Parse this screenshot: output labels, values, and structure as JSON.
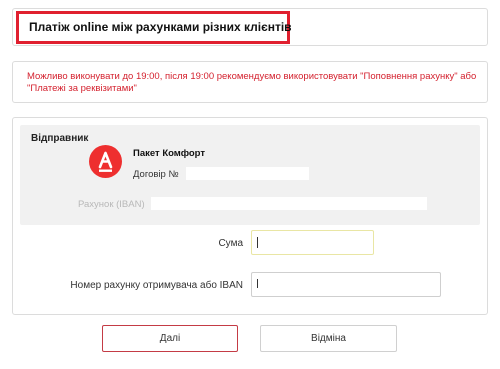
{
  "header": {
    "title": "Платіж online між рахунками різних клієнтів"
  },
  "notice": {
    "text": "Можливо виконувати до 19:00, після 19:00 рекомендуємо використовувати \"Поповнення рахунку\" або \"Платежі за реквізитами\""
  },
  "sender": {
    "title": "Відправник",
    "logo_icon": "alfa-bank-logo-icon",
    "package_name": "Пакет Комфорт",
    "contract_label": "Договір №",
    "account_label": "Рахунок (IBAN)"
  },
  "form": {
    "amount_label": "Сума",
    "amount_value": "",
    "recipient_label": "Номер рахунку отримувача або IBAN",
    "recipient_value": ""
  },
  "buttons": {
    "next_label": "Далі",
    "cancel_label": "Відміна"
  },
  "colors": {
    "accent": "#e0202f",
    "notice_text": "#d4222f",
    "logo_bg": "#ee2f2f"
  }
}
